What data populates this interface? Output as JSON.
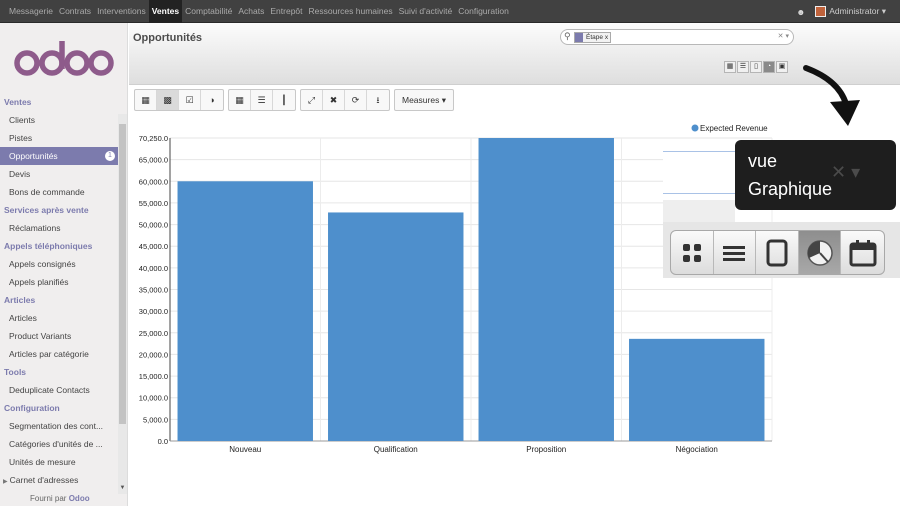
{
  "topbar": {
    "menu": [
      "Messagerie",
      "Contrats",
      "Interventions",
      "Ventes",
      "Comptabilité",
      "Achats",
      "Entrepôt",
      "Ressources humaines",
      "Suivi d'activité",
      "Configuration"
    ],
    "active": "Ventes",
    "user": "Administrator"
  },
  "sidebar": {
    "sections": [
      {
        "title": "Ventes",
        "items": [
          "Clients",
          "Pistes",
          "Opportunités",
          "Devis",
          "Bons de commande"
        ]
      },
      {
        "title": "Services après vente",
        "items": [
          "Réclamations"
        ]
      },
      {
        "title": "Appels téléphoniques",
        "items": [
          "Appels consignés",
          "Appels planifiés"
        ]
      },
      {
        "title": "Articles",
        "items": [
          "Articles",
          "Product Variants",
          "Articles par catégorie"
        ]
      },
      {
        "title": "Tools",
        "items": [
          "Deduplicate Contacts"
        ]
      },
      {
        "title": "Configuration",
        "items": [
          "Segmentation des cont...",
          "Catégories d'unités de ...",
          "Unités de mesure",
          "Carnet d'adresses"
        ]
      }
    ],
    "active_item": "Opportunités",
    "active_badge": "1",
    "powered_prefix": "Fourni par",
    "powered_brand": "Odoo"
  },
  "header": {
    "title": "Opportunités",
    "search_facet": "Étape",
    "search_facet_close": "x"
  },
  "toolbar": {
    "measures_label": "Measures"
  },
  "callout": {
    "line1": "vue",
    "line2": "Graphique"
  },
  "chart_data": {
    "type": "bar",
    "categories": [
      "Nouveau",
      "Qualification",
      "Proposition",
      "Négociation"
    ],
    "series": [
      {
        "name": "Expected Revenue",
        "values": [
          60000,
          52800,
          70000,
          23600
        ]
      }
    ],
    "ylim": [
      0,
      70000
    ],
    "yticks": [
      "0.0",
      "5,000.0",
      "10,000.0",
      "15,000.0",
      "20,000.0",
      "25,000.0",
      "30,000.0",
      "35,000.0",
      "40,000.0",
      "45,000.0",
      "50,000.0",
      "55,000.0",
      "60,000.0",
      "65,000.0",
      "70,250.0"
    ],
    "grid": true,
    "legend": "top-right",
    "bar_color": "#4e8fcc"
  }
}
